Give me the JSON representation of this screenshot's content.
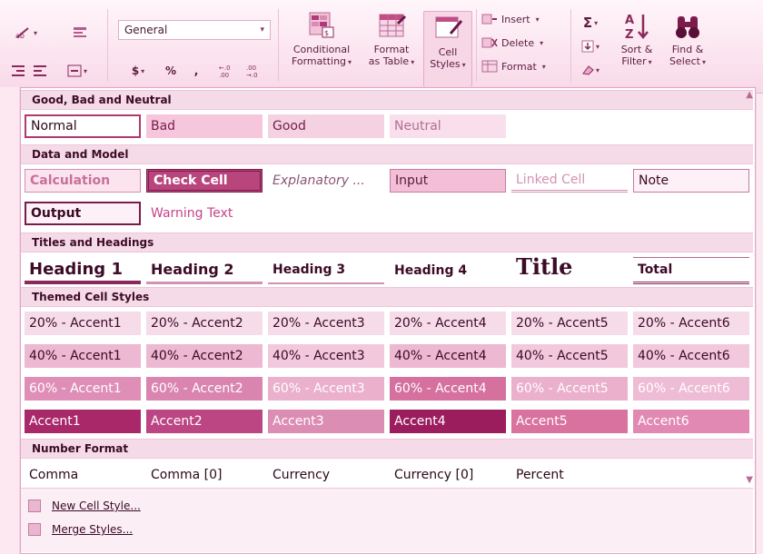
{
  "ribbon": {
    "number_format_value": "General",
    "currency_symbol": "$",
    "percent_symbol": "%",
    "comma_symbol": ",",
    "inc_decimal": ".0→.00",
    "dec_decimal": ".00→.0",
    "conditional_formatting": [
      "Conditional",
      "Formatting"
    ],
    "format_as_table": [
      "Format",
      "as Table"
    ],
    "cell_styles": [
      "Cell",
      "Styles"
    ],
    "insert": "Insert",
    "delete": "Delete",
    "format": "Format",
    "sort_filter": [
      "Sort &",
      "Filter"
    ],
    "find_select": [
      "Find &",
      "Select"
    ]
  },
  "sections": {
    "good_bad": "Good, Bad and Neutral",
    "data_model": "Data and Model",
    "titles": "Titles and Headings",
    "themed": "Themed Cell Styles",
    "number": "Number Format"
  },
  "good_bad_styles": [
    "Normal",
    "Bad",
    "Good",
    "Neutral"
  ],
  "data_model_styles": [
    "Calculation",
    "Check Cell",
    "Explanatory ...",
    "Input",
    "Linked Cell",
    "Note",
    "Output",
    "Warning Text"
  ],
  "title_styles": [
    "Heading 1",
    "Heading 2",
    "Heading 3",
    "Heading 4",
    "Title",
    "Total"
  ],
  "themed_rows": [
    [
      "20% - Accent1",
      "20% - Accent2",
      "20% - Accent3",
      "20% - Accent4",
      "20% - Accent5",
      "20% - Accent6"
    ],
    [
      "40% - Accent1",
      "40% - Accent2",
      "40% - Accent3",
      "40% - Accent4",
      "40% - Accent5",
      "40% - Accent6"
    ],
    [
      "60% - Accent1",
      "60% - Accent2",
      "60% - Accent3",
      "60% - Accent4",
      "60% - Accent5",
      "60% - Accent6"
    ],
    [
      "Accent1",
      "Accent2",
      "Accent3",
      "Accent4",
      "Accent5",
      "Accent6"
    ]
  ],
  "number_styles": [
    "Comma",
    "Comma [0]",
    "Currency",
    "Currency [0]",
    "Percent"
  ],
  "footer": {
    "new_style": "New Cell Style...",
    "merge_styles": "Merge Styles..."
  },
  "colors": {
    "accent_dark": "#a8286a",
    "accent_mid": "#d06d9f",
    "tint_20": "#f6dbe8",
    "tint_40": "#ecb8d2",
    "tint_60": "#df8fb7"
  }
}
